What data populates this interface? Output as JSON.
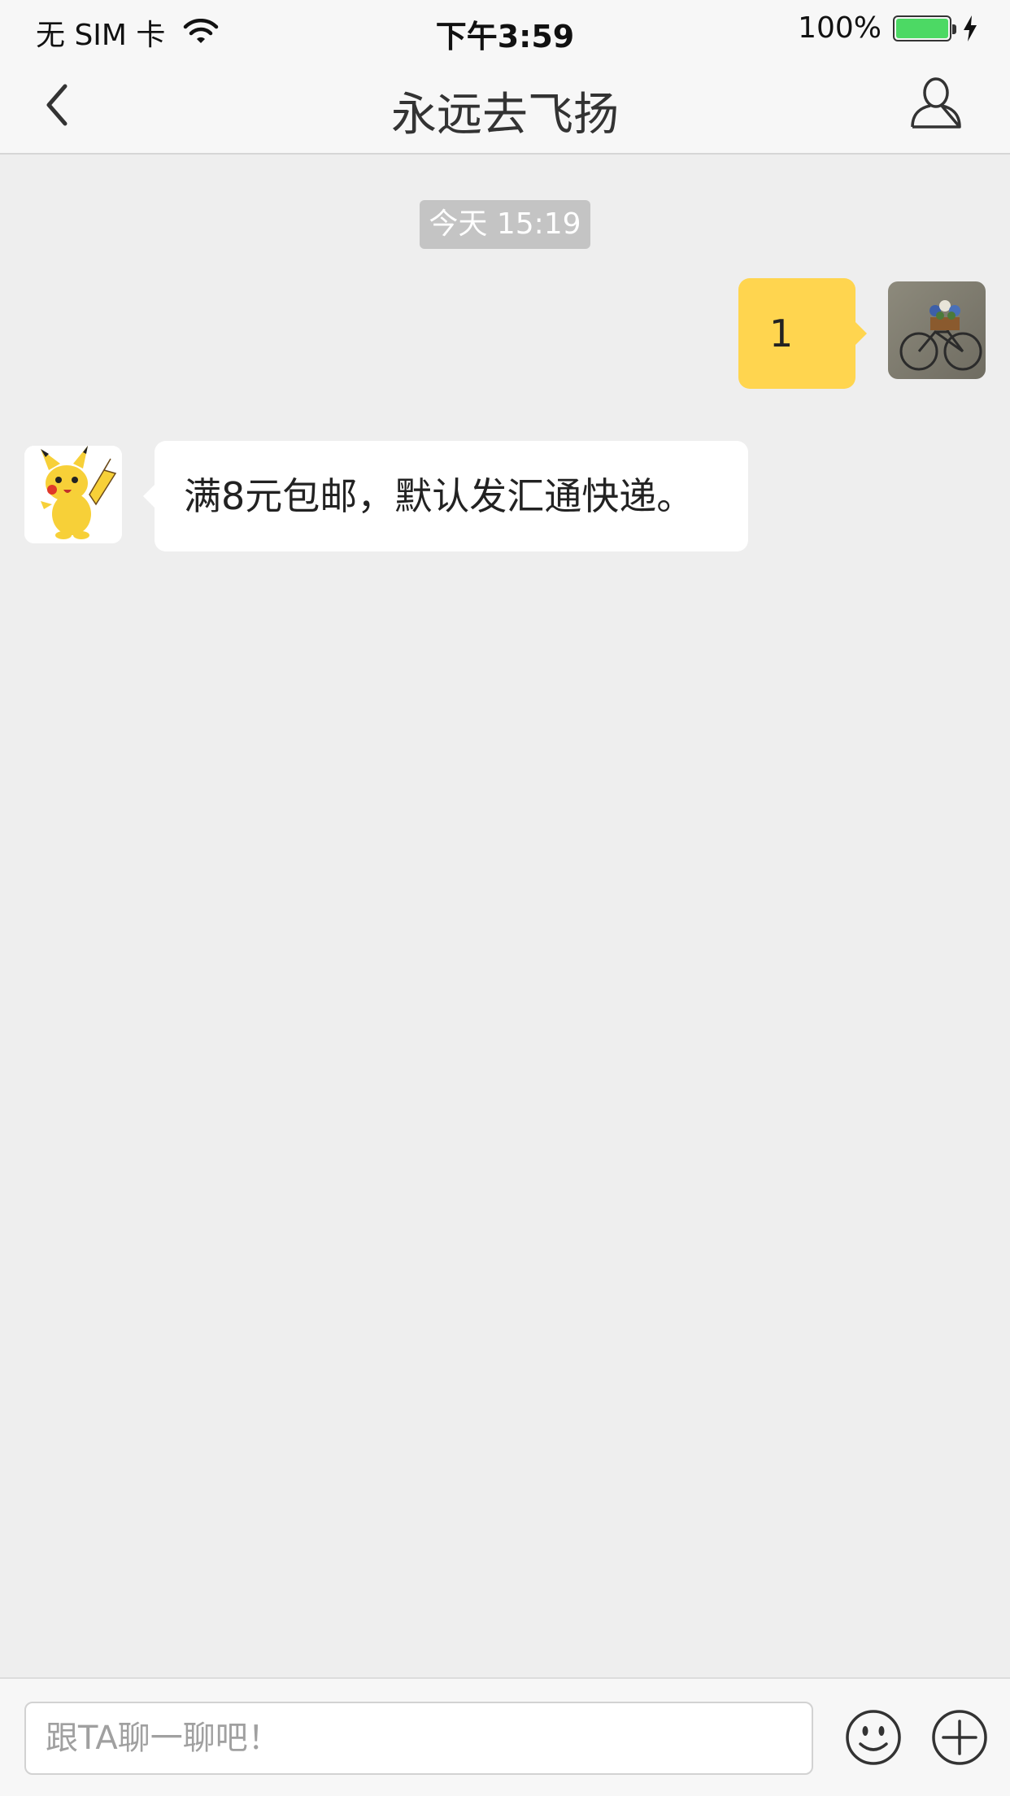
{
  "status_bar": {
    "carrier": "无 SIM 卡",
    "time": "下午3:59",
    "battery_percent": "100%",
    "battery_level": 1.0,
    "battery_color": "#4cd964"
  },
  "nav": {
    "title": "永远去飞扬",
    "back_icon": "chevron-left-icon",
    "profile_icon": "person-icon"
  },
  "chat": {
    "timestamp": "今天 15:19",
    "messages": [
      {
        "direction": "outgoing",
        "text": "1",
        "bubble_color": "#ffd54f"
      },
      {
        "direction": "incoming",
        "text": "满8元包邮，默认发汇通快递。",
        "bubble_color": "#ffffff"
      }
    ]
  },
  "input_bar": {
    "placeholder": "跟TA聊一聊吧！",
    "emoji_icon": "smiley-icon",
    "plus_icon": "plus-circle-icon"
  }
}
